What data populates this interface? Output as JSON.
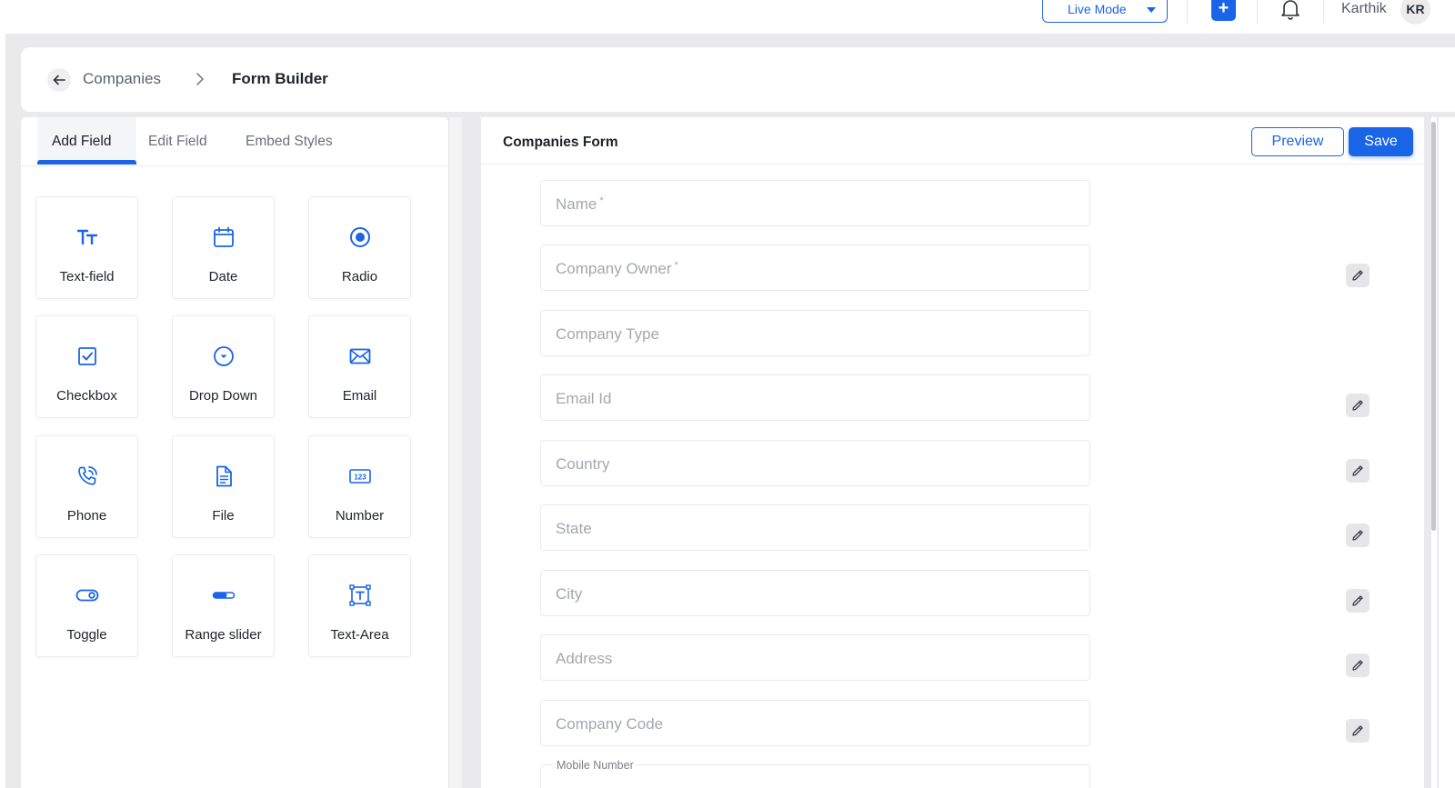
{
  "topbar": {
    "mode_label": "Live Mode",
    "create_label": "+",
    "user_name": "Karthik",
    "user_initials": "KR"
  },
  "breadcrumb": {
    "parent": "Companies",
    "current": "Form Builder"
  },
  "palette": {
    "tabs": [
      {
        "label": "Add Field",
        "active": true
      },
      {
        "label": "Edit Field",
        "active": false
      },
      {
        "label": "Embed Styles",
        "active": false
      }
    ],
    "fields": [
      {
        "label": "Text-field",
        "icon": "text-field-icon"
      },
      {
        "label": "Date",
        "icon": "calendar-icon"
      },
      {
        "label": "Radio",
        "icon": "radio-icon"
      },
      {
        "label": "Checkbox",
        "icon": "checkbox-icon"
      },
      {
        "label": "Drop Down",
        "icon": "dropdown-icon"
      },
      {
        "label": "Email",
        "icon": "envelope-icon"
      },
      {
        "label": "Phone",
        "icon": "phone-icon"
      },
      {
        "label": "File",
        "icon": "file-icon"
      },
      {
        "label": "Number",
        "icon": "number-icon"
      },
      {
        "label": "Toggle",
        "icon": "toggle-icon"
      },
      {
        "label": "Range slider",
        "icon": "range-slider-icon"
      },
      {
        "label": "Text-Area",
        "icon": "text-area-icon"
      }
    ]
  },
  "form": {
    "title": "Companies Form",
    "preview_label": "Preview",
    "save_label": "Save",
    "fields": [
      {
        "placeholder": "Name",
        "required_mark": "*"
      },
      {
        "placeholder": "Company Owner",
        "required_mark": "*"
      },
      {
        "placeholder": "Company Type"
      },
      {
        "placeholder": "Email Id"
      },
      {
        "placeholder": "Country"
      },
      {
        "placeholder": "State"
      },
      {
        "placeholder": "City"
      },
      {
        "placeholder": "Address"
      },
      {
        "placeholder": "Company Code"
      }
    ],
    "partial_field_label": "Mobile Number"
  },
  "colors": {
    "accent": "#1a64e8",
    "workspace_bg": "#eaeaec"
  }
}
